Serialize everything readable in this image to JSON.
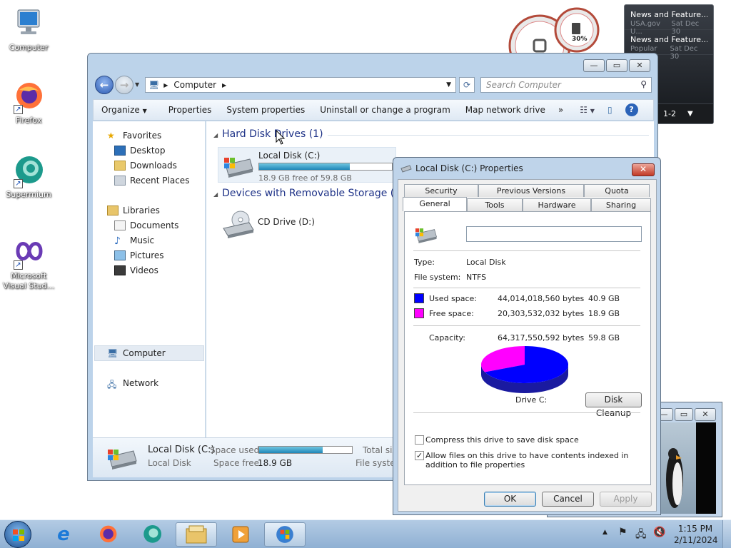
{
  "desktop": {
    "icons": [
      {
        "label": "Computer"
      },
      {
        "label": "Firefox"
      },
      {
        "label": "Supermium"
      },
      {
        "label": "Microsoft Visual Stud..."
      }
    ]
  },
  "gauge_gadget": {
    "percent": "30%"
  },
  "news_gadget": {
    "items": [
      {
        "title": "News and Feature...",
        "source": "USA.gov U...",
        "date": "Sat Dec 30"
      },
      {
        "title": "News and Feature...",
        "source": "Popular G...",
        "date": "Sat Dec 30"
      }
    ],
    "pager": "1-2"
  },
  "explorer": {
    "address": "Computer",
    "search_placeholder": "Search Computer",
    "toolbar": [
      "Organize",
      "Properties",
      "System properties",
      "Uninstall or change a program",
      "Map network drive"
    ],
    "more_label": "»",
    "nav": {
      "favorites": "Favorites",
      "desktop": "Desktop",
      "downloads": "Downloads",
      "recent": "Recent Places",
      "libraries": "Libraries",
      "documents": "Documents",
      "music": "Music",
      "pictures": "Pictures",
      "videos": "Videos",
      "computer": "Computer",
      "network": "Network"
    },
    "groups": {
      "hdd": "Hard Disk Drives (1)",
      "removable": "Devices with Removable Storage (1)"
    },
    "local_disk": {
      "name": "Local Disk (C:)",
      "free_text": "18.9 GB free of 59.8 GB",
      "used_fraction": 0.684
    },
    "cd_drive": {
      "name": "CD Drive (D:)"
    },
    "details": {
      "name": "Local Disk (C:)",
      "type": "Local Disk",
      "space_used_label": "Space used:",
      "space_free_label": "Space free:",
      "space_free_value": "18.9 GB",
      "total_label": "Total siz",
      "fs_label": "File syster",
      "used_fraction": 0.684
    }
  },
  "properties": {
    "title": "Local Disk (C:) Properties",
    "tabs_row1": [
      "Security",
      "Previous Versions",
      "Quota"
    ],
    "tabs_row2": [
      "General",
      "Tools",
      "Hardware",
      "Sharing"
    ],
    "name_value": "",
    "type_label": "Type:",
    "type_value": "Local Disk",
    "fs_label": "File system:",
    "fs_value": "NTFS",
    "used_label": "Used space:",
    "used_bytes": "44,014,018,560 bytes",
    "used_gb": "40.9 GB",
    "free_label": "Free space:",
    "free_bytes": "20,303,532,032 bytes",
    "free_gb": "18.9 GB",
    "capacity_label": "Capacity:",
    "capacity_bytes": "64,317,550,592 bytes",
    "capacity_gb": "59.8 GB",
    "drive_label": "Drive C:",
    "cleanup_button": "Disk Cleanup",
    "compress_label": "Compress this drive to save disk space",
    "compress_checked": false,
    "index_label": "Allow files on this drive to have contents indexed in addition to file properties",
    "index_checked": true,
    "ok": "OK",
    "cancel": "Cancel",
    "apply": "Apply",
    "colors": {
      "used": "#0000ff",
      "free": "#ff00ff"
    }
  },
  "taskbar": {
    "time": "1:15 PM",
    "date": "2/11/2024"
  }
}
